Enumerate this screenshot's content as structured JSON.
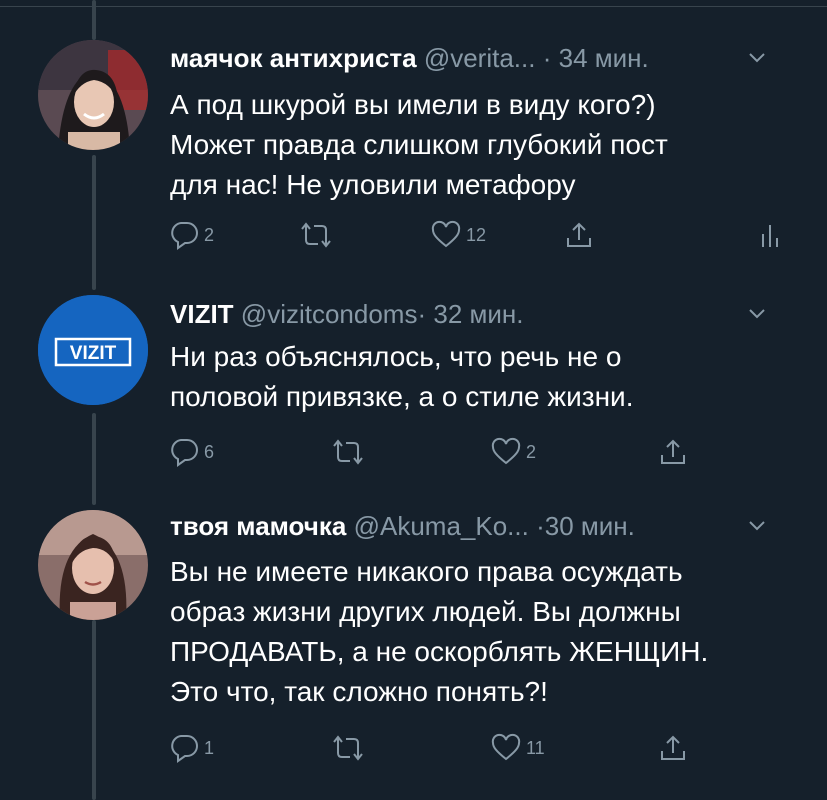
{
  "tweets": [
    {
      "name": "маячок антихриста",
      "handle": "@verita...",
      "dot": "·",
      "time": "34 мин.",
      "text_lines": [
        "А под шкурой вы имели в виду кого?)",
        "Может правда слишком глубокий пост",
        "для нас! Не уловили метафору"
      ],
      "reply_count": "2",
      "retweet_count": "",
      "like_count": "12",
      "has_analytics": true
    },
    {
      "name": "VIZIT",
      "handle": "@vizitcondoms",
      "dot": "·",
      "time": "32 мин.",
      "avatar_logo": "VIZIT",
      "text_lines": [
        "Ни раз объяснялось, что речь не о",
        "половой привязке, а о стиле жизни."
      ],
      "reply_count": "6",
      "retweet_count": "",
      "like_count": "2",
      "has_analytics": false
    },
    {
      "name": "твоя мамочка",
      "handle": "@Akuma_Ko...",
      "dot": "·",
      "time": "30 мин.",
      "text_lines": [
        "Вы не имеете никакого права осуждать",
        "образ жизни других людей. Вы должны",
        "ПРОДАВАТЬ, а не оскорблять ЖЕНЩИН.",
        "Это что, так сложно понять?!"
      ],
      "reply_count": "1",
      "retweet_count": "",
      "like_count": "11",
      "has_analytics": false
    }
  ],
  "colors": {
    "background": "#15202b",
    "text": "#ffffff",
    "secondary": "#8899a6",
    "divider": "#38444d",
    "vizit_blue": "#1565c0"
  },
  "icons": [
    "reply-icon",
    "retweet-icon",
    "like-icon",
    "share-icon",
    "analytics-icon",
    "chevron-down-icon"
  ]
}
